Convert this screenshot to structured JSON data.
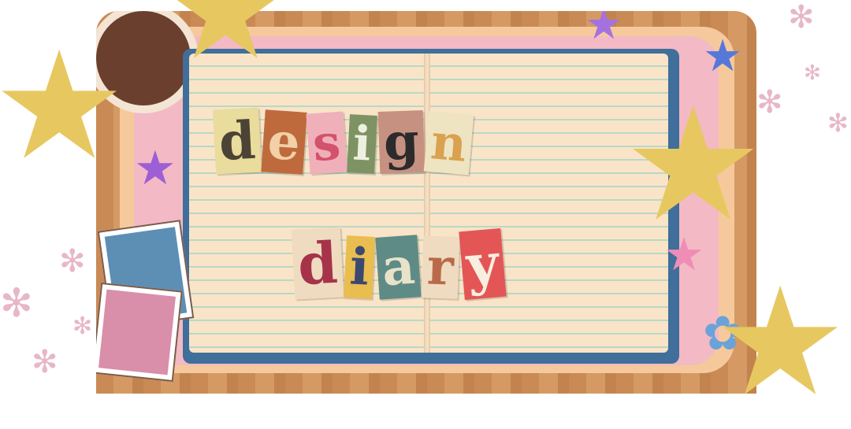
{
  "title": {
    "line1": "design",
    "line2": "diary"
  },
  "palette": {
    "wood": "#c98a55",
    "page": "#f9e4c8",
    "star_gold": "#e7c860",
    "sparkle_pink": "#e8b7c7",
    "book_blue": "#3f6f9a"
  },
  "icons": {
    "stars": "gold-star-icon",
    "sparkles": "snowflake-sparkle-icon",
    "coffee": "coffee-mug-icon",
    "photos": "polaroid-photo-icon"
  }
}
